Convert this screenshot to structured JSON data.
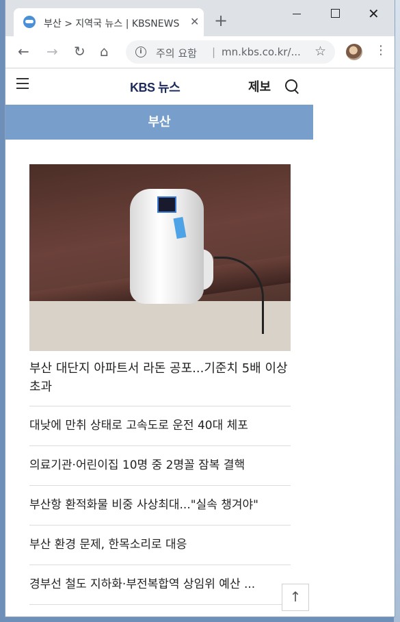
{
  "browser": {
    "tab": {
      "title": "부산 > 지역국 뉴스 | KBSNEWS",
      "close_glyph": "✕"
    },
    "new_tab_glyph": "+",
    "window_controls": {
      "close_glyph": "✕"
    },
    "toolbar": {
      "back_glyph": "←",
      "forward_glyph": "→",
      "reload_glyph": "↻",
      "home_glyph": "⌂",
      "security_warning": "주의 요함",
      "separator": "|",
      "url": "mn.kbs.co.kr/...",
      "star_glyph": "☆",
      "menu_glyph": "⋮"
    }
  },
  "site": {
    "logo": "KBS 뉴스",
    "report_label": "제보",
    "region": "부산"
  },
  "news": {
    "featured_headline": "부산 대단지 아파트서 라돈 공포...기준치 5배 이상 초과",
    "items": [
      "대낮에 만취 상태로 고속도로 운전 40대 체포",
      "의료기관·어린이집 10명 중 2명꼴 잠복 결핵",
      "부산항 환적화물 비중 사상최대...\"실속 챙겨야\"",
      "부산 환경 문제, 한목소리로 대응",
      "경부선 철도 지하화·부전복합역 상임위 예산 ..."
    ]
  },
  "scroll_top_glyph": "↑",
  "colors": {
    "region_bar": "#789fcb",
    "logo": "#1c2a5a"
  }
}
